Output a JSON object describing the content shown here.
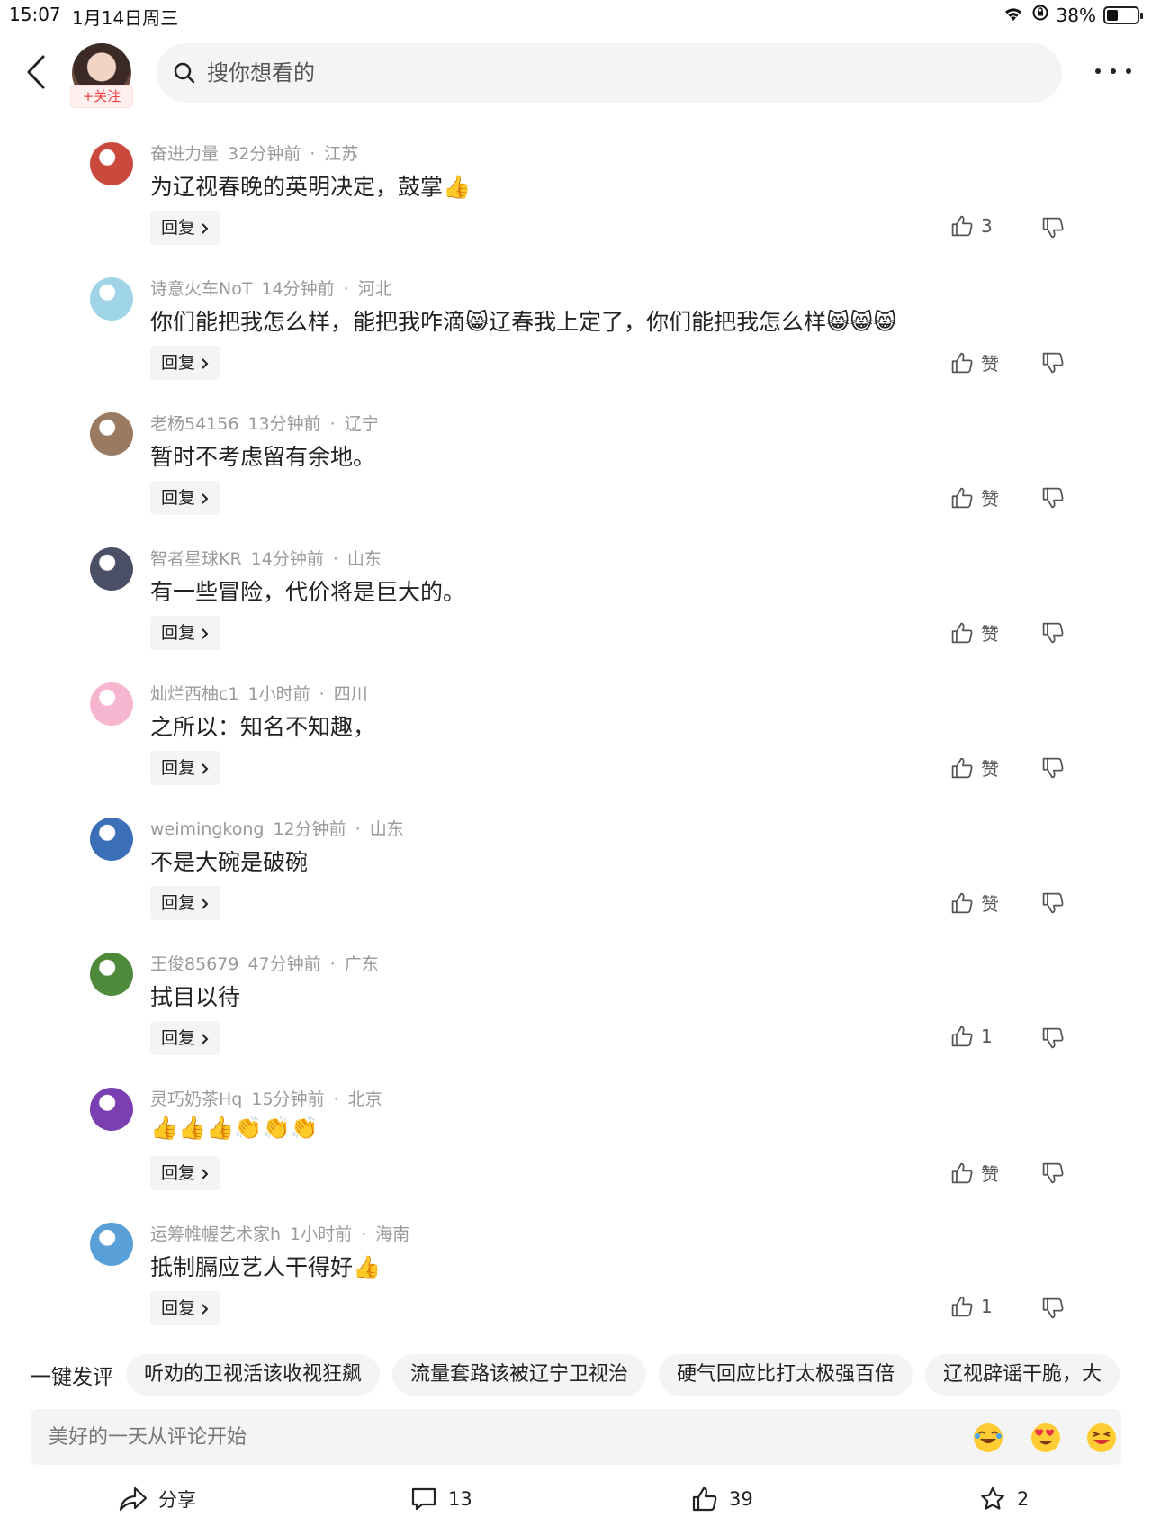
{
  "status": {
    "time": "15:07",
    "date": "1月14日周三",
    "battery": "38%",
    "battery_level": 0.38
  },
  "header": {
    "follow_label": "+关注",
    "search_placeholder": "搜你想看的"
  },
  "comments": [
    {
      "user": "奋进力量",
      "time": "32分钟前",
      "location": "江苏",
      "text": "为辽视春晚的英明决定，鼓掌",
      "emojis": "👍",
      "reply": "回复",
      "likes": "3",
      "avatar_color": "#c94a3c"
    },
    {
      "user": "诗意火车NoT",
      "time": "14分钟前",
      "location": "河北",
      "text": "你们能把我怎么样，能把我咋滴😸辽春我上定了，你们能把我怎么样",
      "emojis": "😸😸😸",
      "reply": "回复",
      "likes": "赞",
      "avatar_color": "#9fd3e6"
    },
    {
      "user": "老杨54156",
      "time": "13分钟前",
      "location": "辽宁",
      "text": "暂时不考虑留有余地。",
      "emojis": "",
      "reply": "回复",
      "likes": "赞",
      "avatar_color": "#9a7a60"
    },
    {
      "user": "智者星球KR",
      "time": "14分钟前",
      "location": "山东",
      "text": "有一些冒险，代价将是巨大的。",
      "emojis": "",
      "reply": "回复",
      "likes": "赞",
      "avatar_color": "#4a4f66"
    },
    {
      "user": "灿烂西柚c1",
      "time": "1小时前",
      "location": "四川",
      "text": "之所以：知名不知趣，",
      "emojis": "",
      "reply": "回复",
      "likes": "赞",
      "avatar_color": "#f7b6cf"
    },
    {
      "user": "weimingkong",
      "time": "12分钟前",
      "location": "山东",
      "text": "不是大碗是破碗",
      "emojis": "",
      "reply": "回复",
      "likes": "赞",
      "avatar_color": "#3b6fb8"
    },
    {
      "user": "王俊85679",
      "time": "47分钟前",
      "location": "广东",
      "text": "拭目以待",
      "emojis": "",
      "reply": "回复",
      "likes": "1",
      "avatar_color": "#4f8a3c"
    },
    {
      "user": "灵巧奶茶Hq",
      "time": "15分钟前",
      "location": "北京",
      "text": "",
      "emojis": "👍👍👍👏👏👏",
      "reply": "回复",
      "likes": "赞",
      "avatar_color": "#7a3fb0"
    },
    {
      "user": "运筹帷幄艺术家h",
      "time": "1小时前",
      "location": "海南",
      "text": "抵制膈应艺人干得好",
      "emojis": "👍",
      "reply": "回复",
      "likes": "1",
      "avatar_color": "#5aa0d8"
    }
  ],
  "quick_comment": {
    "title": "一键发评",
    "chips": [
      "听劝的卫视活该收视狂飙",
      "流量套路该被辽宁卫视治",
      "硬气回应比打太极强百倍",
      "辽视辟谣干脆，大"
    ]
  },
  "comment_input": {
    "placeholder": "美好的一天从评论开始",
    "emojis": [
      "😂",
      "😍",
      "😆"
    ]
  },
  "bottom_bar": {
    "share_label": "分享",
    "comments_count": "13",
    "likes_count": "39",
    "favorites_count": "2"
  }
}
